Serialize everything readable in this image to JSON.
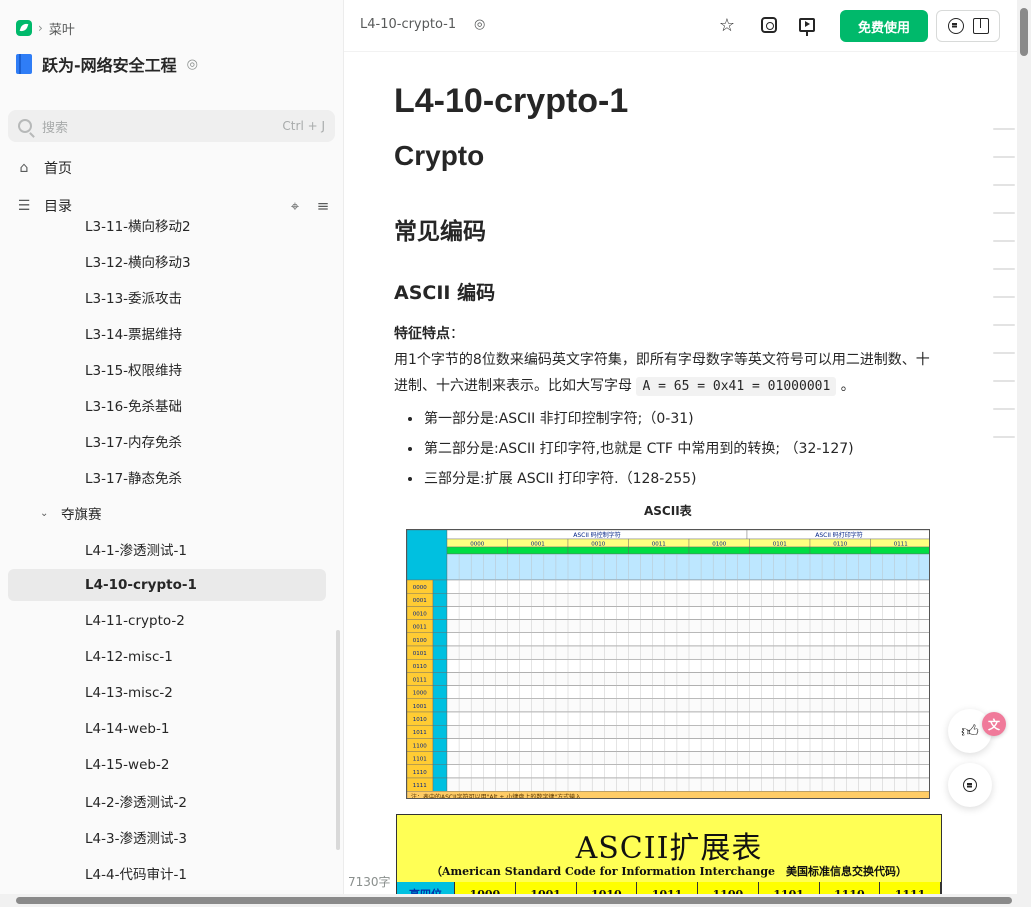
{
  "breadcrumb": {
    "label": "菜叶"
  },
  "book": {
    "title": "跃为-网络安全工程"
  },
  "search": {
    "placeholder": "搜索",
    "shortcut": "Ctrl + J"
  },
  "nav": {
    "home": "首页",
    "toc": "目录"
  },
  "tree": {
    "items": [
      {
        "label": "L3-11-横向移动2"
      },
      {
        "label": "L3-12-横向移动3"
      },
      {
        "label": "L3-13-委派攻击"
      },
      {
        "label": "L3-14-票据维持"
      },
      {
        "label": "L3-15-权限维持"
      },
      {
        "label": "L3-16-免杀基础"
      },
      {
        "label": "L3-17-内存免杀"
      },
      {
        "label": "L3-17-静态免杀"
      }
    ],
    "group": {
      "label": "夺旗赛"
    },
    "group_items": [
      {
        "label": "L4-1-渗透测试-1"
      },
      {
        "label": "L4-10-crypto-1"
      },
      {
        "label": "L4-11-crypto-2"
      },
      {
        "label": "L4-12-misc-1"
      },
      {
        "label": "L4-13-misc-2"
      },
      {
        "label": "L4-14-web-1"
      },
      {
        "label": "L4-15-web-2"
      },
      {
        "label": "L4-2-渗透测试-2"
      },
      {
        "label": "L4-3-渗透测试-3"
      },
      {
        "label": "L4-4-代码审计-1"
      }
    ],
    "active_label": "L4-10-crypto-1"
  },
  "header": {
    "doc_title": "L4-10-crypto-1",
    "free_button": "免费使用"
  },
  "doc": {
    "h1": "L4-10-crypto-1",
    "h_crypto": "Crypto",
    "h2": "常见编码",
    "h3": "ASCII 编码",
    "feature_label": "特征特点",
    "feature_colon": "：",
    "body_text": "用1个字节的8位数来编码英文字符集，即所有字母数字等英文符号可以用二进制数、十进制、十六进制来表示。比如大写字母",
    "code": "A = 65 = 0x41 = 01000001",
    "body_end": "。",
    "bullets": [
      "第一部分是:ASCII 非打印控制字符;（0-31)",
      "第二部分是:ASCII 打印字符,也就是 CTF 中常用到的转换; （32-127)",
      "三部分是:扩展 ASCII 打印字符.（128-255)"
    ],
    "table_caption": "ASCII表",
    "ascii_table": {
      "header_left": "ASCII 码控制字符",
      "header_right": "ASCII 码打印字符",
      "high_codes": [
        "0000",
        "0001",
        "0010",
        "0011",
        "0100",
        "0101",
        "0110",
        "0111"
      ],
      "low_codes": [
        "0000",
        "0001",
        "0010",
        "0011",
        "0100",
        "0101",
        "0110",
        "0111",
        "1000",
        "1001",
        "1010",
        "1011",
        "1100",
        "1101",
        "1110",
        "1111"
      ],
      "footer": "注：表中的ASCII字符可以用\"Alt + 小键盘上的数字键\"方式输入"
    },
    "ext_table": {
      "title": "ASCII扩展表",
      "subtitle": "（American Standard Code for Information Interchange　美国标准信息交换代码）",
      "row_label": "高四位",
      "cols": [
        "1000",
        "1001",
        "1010",
        "1011",
        "1100",
        "1101",
        "1110",
        "1111"
      ]
    }
  },
  "footer": {
    "word_count": "7130字"
  },
  "colors": {
    "accent": "#00b96b",
    "sidebar_bg": "#fafafa",
    "active_bg": "#eaeaea"
  }
}
